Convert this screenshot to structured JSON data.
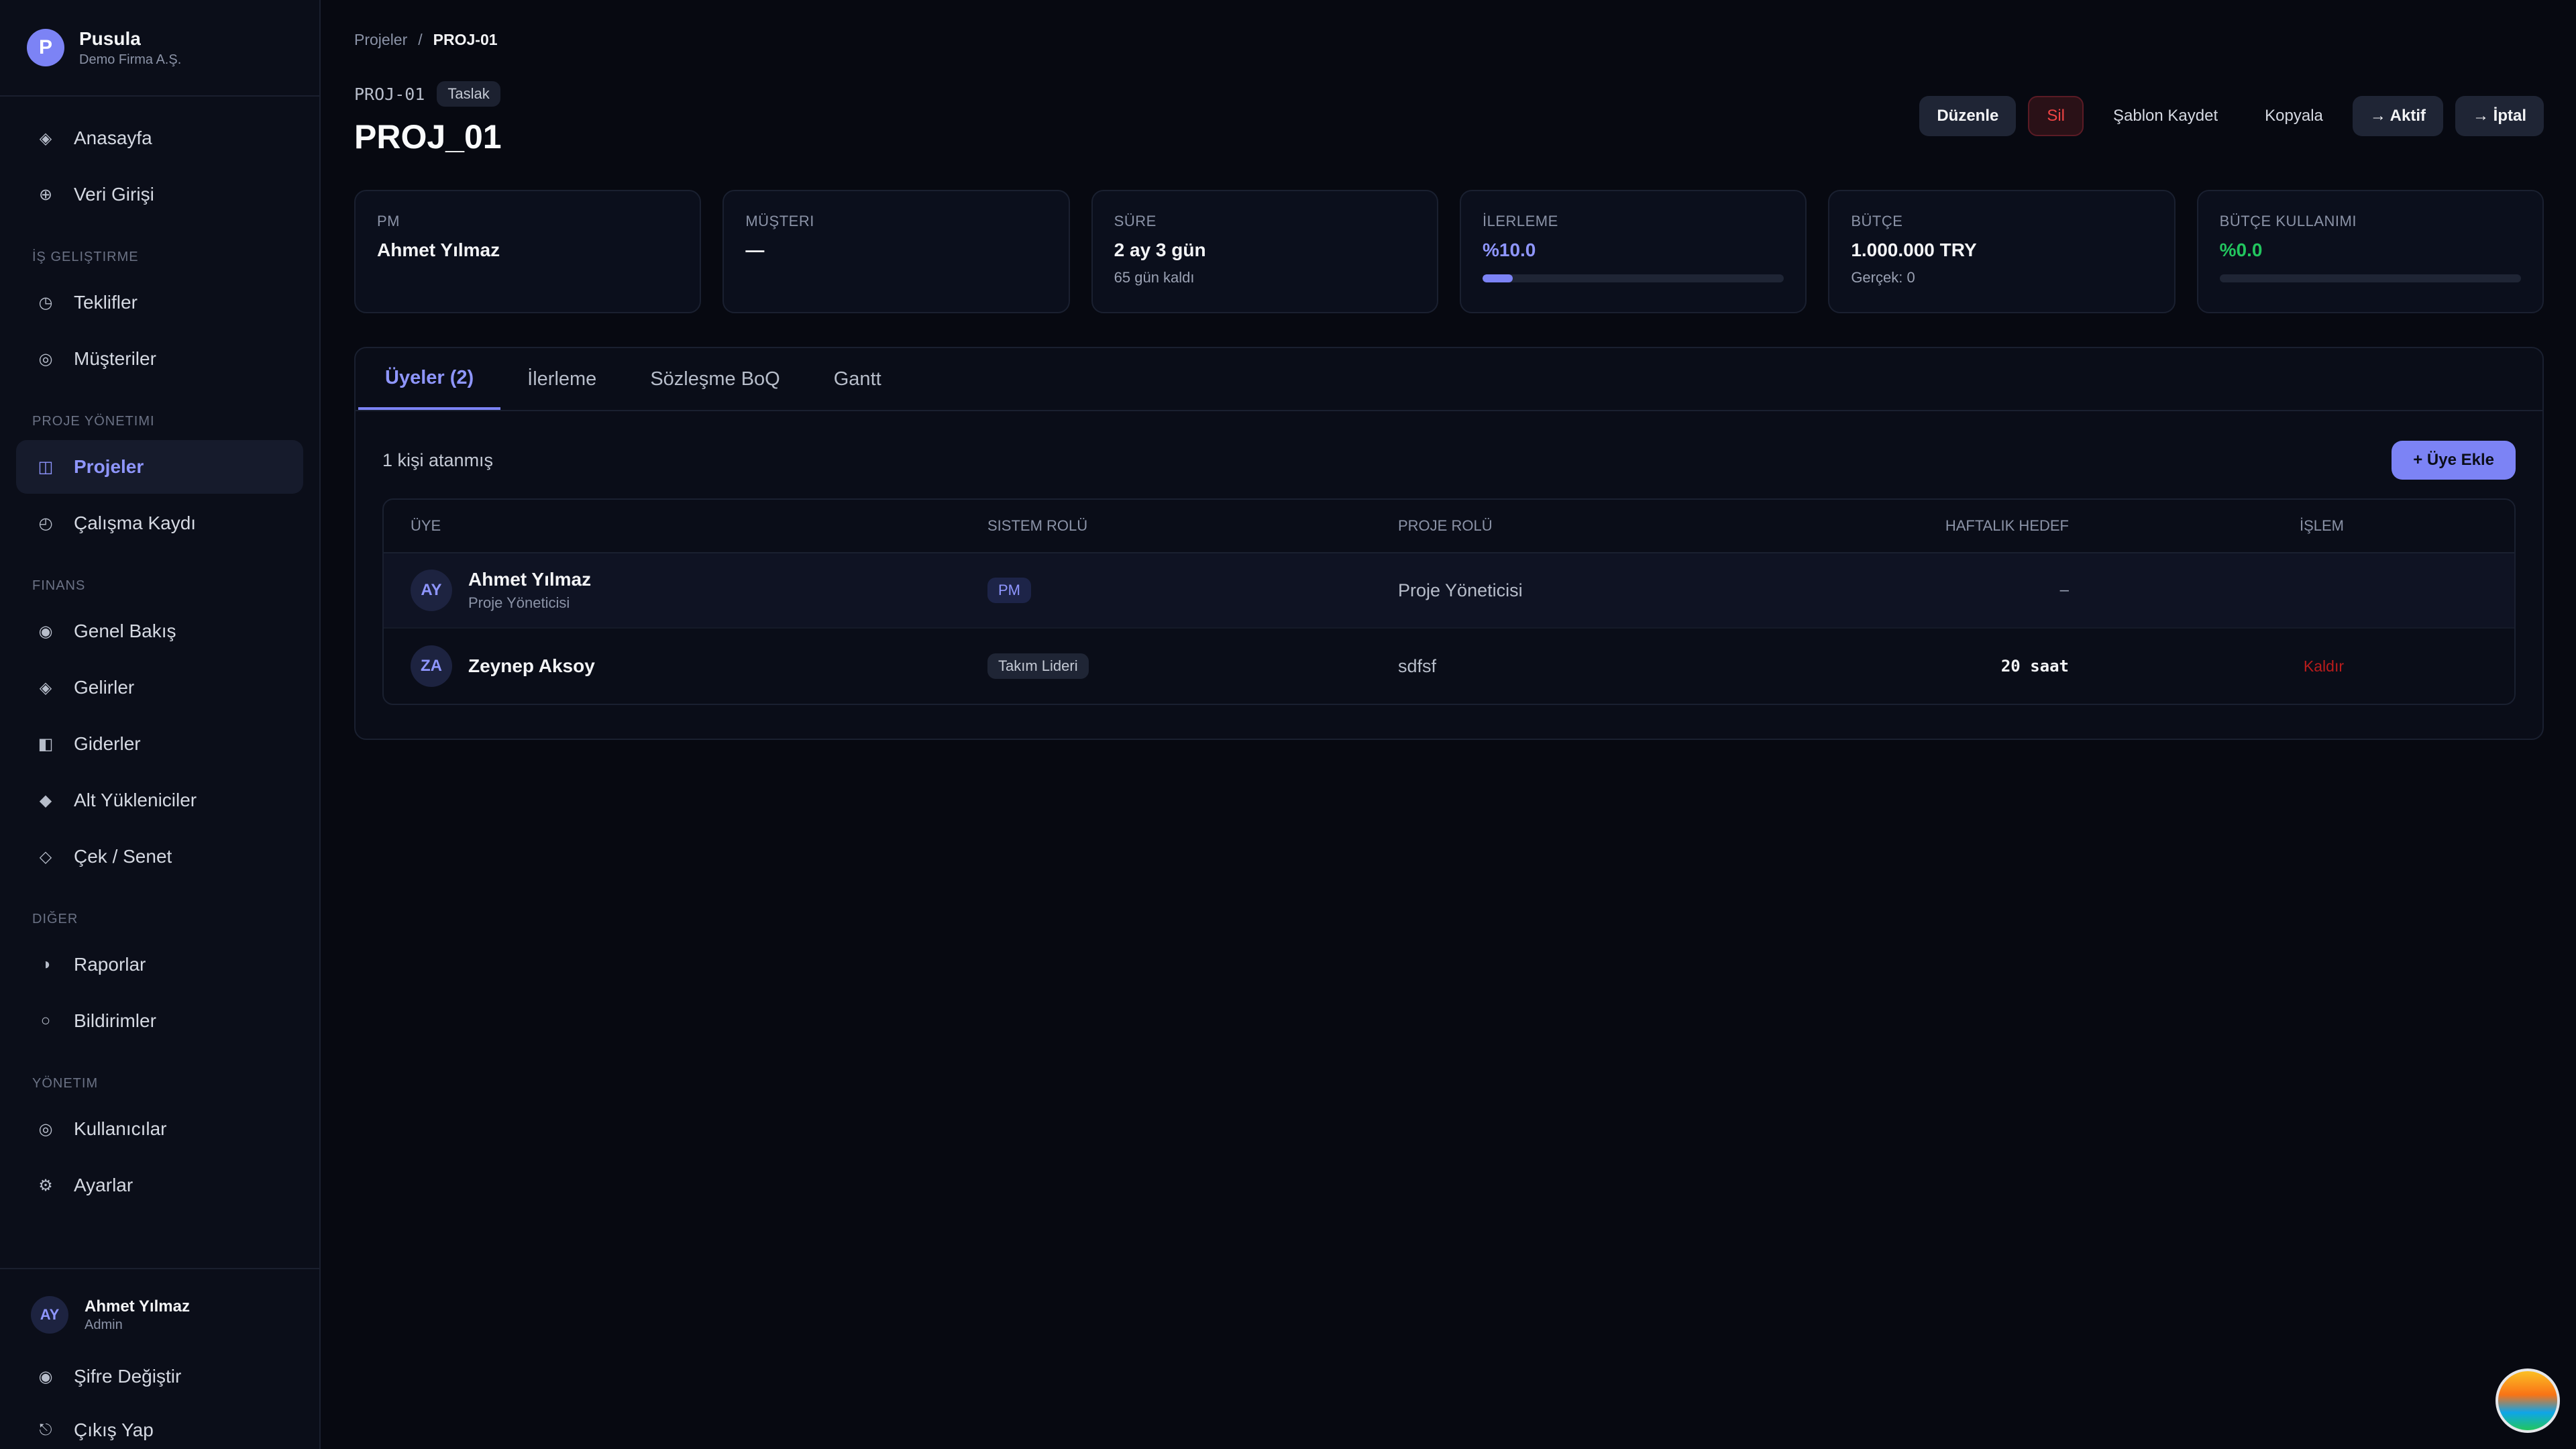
{
  "brand": {
    "initial": "P",
    "name": "Pusula",
    "company": "Demo Firma A.Ş."
  },
  "nav": {
    "items_top": [
      {
        "label": "Anasayfa",
        "icon": "◈"
      },
      {
        "label": "Veri Girişi",
        "icon": "⊕"
      }
    ],
    "sections": [
      {
        "label": "İş Geliştirme",
        "items": [
          {
            "label": "Teklifler",
            "icon": "◷"
          },
          {
            "label": "Müşteriler",
            "icon": "◎"
          }
        ]
      },
      {
        "label": "Proje Yönetimi",
        "items": [
          {
            "label": "Projeler",
            "icon": "◫"
          },
          {
            "label": "Çalışma Kaydı",
            "icon": "◴"
          }
        ]
      },
      {
        "label": "Finans",
        "items": [
          {
            "label": "Genel Bakış",
            "icon": "◉"
          },
          {
            "label": "Gelirler",
            "icon": "◈"
          },
          {
            "label": "Giderler",
            "icon": "◧"
          },
          {
            "label": "Alt Yükleniciler",
            "icon": "◆"
          },
          {
            "label": "Çek / Senet",
            "icon": "◇"
          }
        ]
      },
      {
        "label": "Diğer",
        "items": [
          {
            "label": "Raporlar",
            "icon": "◑"
          },
          {
            "label": "Bildirimler",
            "icon": "○"
          }
        ]
      },
      {
        "label": "Yönetim",
        "items": [
          {
            "label": "Kullanıcılar",
            "icon": "◎"
          },
          {
            "label": "Ayarlar",
            "icon": "⚙"
          }
        ]
      }
    ]
  },
  "footer": {
    "user_initials": "AY",
    "user_name": "Ahmet Yılmaz",
    "user_role": "Admin",
    "change_password": "Şifre Değiştir",
    "logout": "Çıkış Yap"
  },
  "breadcrumb": {
    "root": "Projeler",
    "sep": "/",
    "current": "PROJ-01"
  },
  "project": {
    "code": "PROJ-01",
    "status": "Taslak",
    "title": "PROJ_01"
  },
  "actions": {
    "edit": "Düzenle",
    "delete": "Sil",
    "save_template": "Şablon Kaydet",
    "copy": "Kopyala",
    "to_active": "→ Aktif",
    "to_cancel": "→ İptal"
  },
  "cards": {
    "pm": {
      "label": "PM",
      "value": "Ahmet Yılmaz"
    },
    "customer": {
      "label": "Müşteri",
      "value": "—"
    },
    "duration": {
      "label": "Süre",
      "value": "2 ay 3 gün",
      "sub": "65 gün kaldı"
    },
    "progress": {
      "label": "İlerleme",
      "value": "%10.0",
      "fraction": 0.1
    },
    "budget": {
      "label": "Bütçe",
      "value": "1.000.000 TRY",
      "sub": "Gerçek: 0"
    },
    "budget_usage": {
      "label": "Bütçe Kullanımı",
      "value": "%0.0",
      "fraction": 0.0
    }
  },
  "tabs": [
    "Üyeler (2)",
    "İlerleme",
    "Sözleşme BoQ",
    "Gantt"
  ],
  "members": {
    "assigned_text": "1 kişi atanmış",
    "add_button": "+ Üye Ekle",
    "columns": {
      "member": "Üye",
      "system_role": "Sistem Rolü",
      "project_role": "Proje Rolü",
      "weekly_target": "Haftalık Hedef",
      "action": "İşlem"
    },
    "rows": [
      {
        "initials": "AY",
        "name": "Ahmet Yılmaz",
        "sub": "Proje Yöneticisi",
        "system_role": "PM",
        "project_role": "Proje Yöneticisi",
        "weekly": "–",
        "action": ""
      },
      {
        "initials": "ZA",
        "name": "Zeynep Aksoy",
        "sub": "",
        "system_role": "Takım Lideri",
        "project_role": "sdfsf",
        "weekly": "20 saat",
        "action": "Kaldır"
      }
    ]
  },
  "colors": {
    "accent": "#7c83f5",
    "danger": "#ef4444",
    "success": "#22c55e",
    "background": "#070911"
  }
}
